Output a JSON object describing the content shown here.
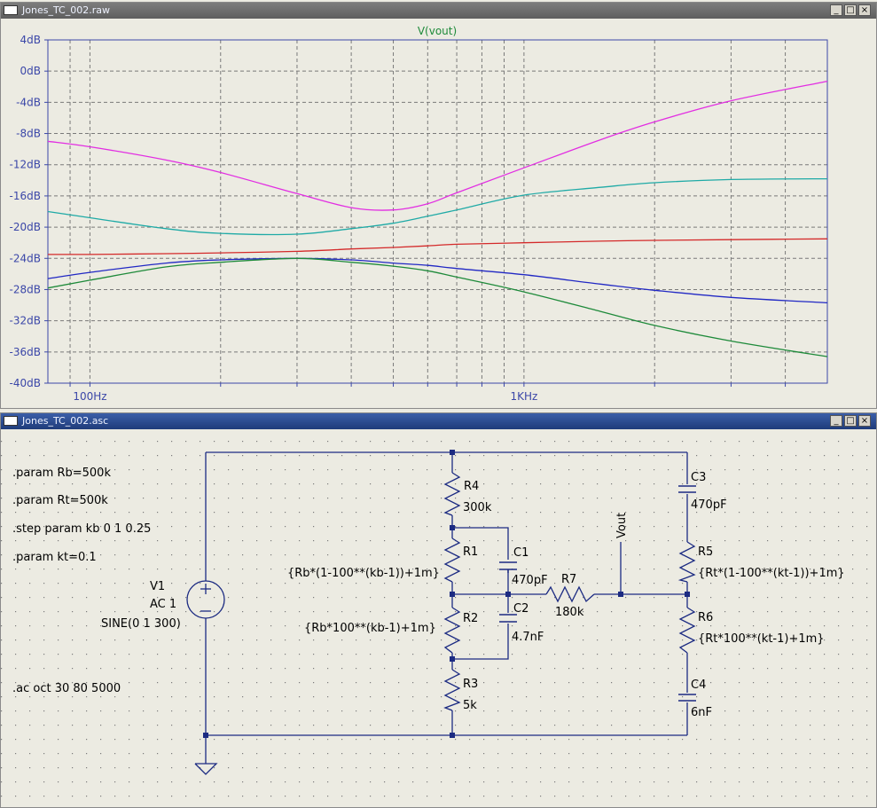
{
  "plot_window": {
    "title": "Jones_TC_002.raw",
    "trace_title": "V(vout)",
    "controls": {
      "minimize": "_",
      "maximize": "□",
      "close": "×"
    }
  },
  "schematic_window": {
    "title": "Jones_TC_002.asc",
    "controls": {
      "minimize": "_",
      "maximize": "□",
      "close": "×"
    }
  },
  "colors": {
    "plot_bg": "#ecebe2",
    "axis": "#3b47a8",
    "series": [
      "#e22ee2",
      "#1faaa6",
      "#d42a2a",
      "#2128c4",
      "#1e8a3a"
    ],
    "wire": "#1c2b82",
    "component": "#1c2b82"
  },
  "chart_data": {
    "type": "line",
    "title": "V(vout)",
    "xlabel": "",
    "ylabel": "",
    "x_scale": "log",
    "xlim": [
      80,
      5000
    ],
    "ylim": [
      -40,
      4
    ],
    "grid": true,
    "x_tick_labels": [
      "100Hz",
      "1KHz"
    ],
    "y_tick_labels": [
      "4dB",
      "0dB",
      "-4dB",
      "-8dB",
      "-12dB",
      "-16dB",
      "-20dB",
      "-24dB",
      "-28dB",
      "-32dB",
      "-36dB",
      "-40dB"
    ],
    "x": [
      80,
      100,
      150,
      200,
      300,
      400,
      500,
      600,
      700,
      1000,
      1500,
      2000,
      3000,
      5000
    ],
    "series": [
      {
        "color": "#e22ee2",
        "values": [
          -9.0,
          -9.7,
          -11.4,
          -13.0,
          -15.7,
          -17.5,
          -17.8,
          -17.0,
          -15.6,
          -12.4,
          -8.8,
          -6.5,
          -3.8,
          -1.3
        ]
      },
      {
        "color": "#1faaa6",
        "values": [
          -18.0,
          -18.8,
          -20.2,
          -20.8,
          -20.9,
          -20.2,
          -19.5,
          -18.6,
          -17.8,
          -15.9,
          -14.9,
          -14.3,
          -13.9,
          -13.8
        ]
      },
      {
        "color": "#d42a2a",
        "values": [
          -23.5,
          -23.5,
          -23.4,
          -23.3,
          -23.1,
          -22.8,
          -22.6,
          -22.4,
          -22.2,
          -22.0,
          -21.8,
          -21.7,
          -21.6,
          -21.5
        ]
      },
      {
        "color": "#2128c4",
        "values": [
          -26.6,
          -25.8,
          -24.6,
          -24.2,
          -24.0,
          -24.2,
          -24.6,
          -24.9,
          -25.3,
          -26.1,
          -27.3,
          -28.1,
          -29.0,
          -29.7
        ]
      },
      {
        "color": "#1e8a3a",
        "values": [
          -27.8,
          -26.8,
          -25.1,
          -24.5,
          -24.0,
          -24.5,
          -25.0,
          -25.6,
          -26.4,
          -28.3,
          -30.8,
          -32.6,
          -34.6,
          -36.6
        ]
      }
    ]
  },
  "schematic": {
    "directives": [
      ".param Rb=500k",
      ".param Rt=500k",
      ".step param kb 0 1 0.25",
      ".param kt=0.1",
      ".ac oct 30 80 5000"
    ],
    "source": {
      "name": "V1",
      "value": "AC 1",
      "spec": "SINE(0 1 300)"
    },
    "components": {
      "R4": {
        "name": "R4",
        "value": "300k"
      },
      "R1": {
        "name": "R1",
        "value": "{Rb*(1-100**(kb-1))+1m}"
      },
      "R2": {
        "name": "R2",
        "value": "{Rb*100**(kb-1)+1m}"
      },
      "R3": {
        "name": "R3",
        "value": "5k"
      },
      "C1": {
        "name": "C1",
        "value": "470pF"
      },
      "C2": {
        "name": "C2",
        "value": "4.7nF"
      },
      "R7": {
        "name": "R7",
        "value": "180k"
      },
      "C3": {
        "name": "C3",
        "value": "470pF"
      },
      "R5": {
        "name": "R5",
        "value": "{Rt*(1-100**(kt-1))+1m}"
      },
      "R6": {
        "name": "R6",
        "value": "{Rt*100**(kt-1)+1m}"
      },
      "C4": {
        "name": "C4",
        "value": "6nF"
      }
    },
    "net_label": "Vout"
  }
}
